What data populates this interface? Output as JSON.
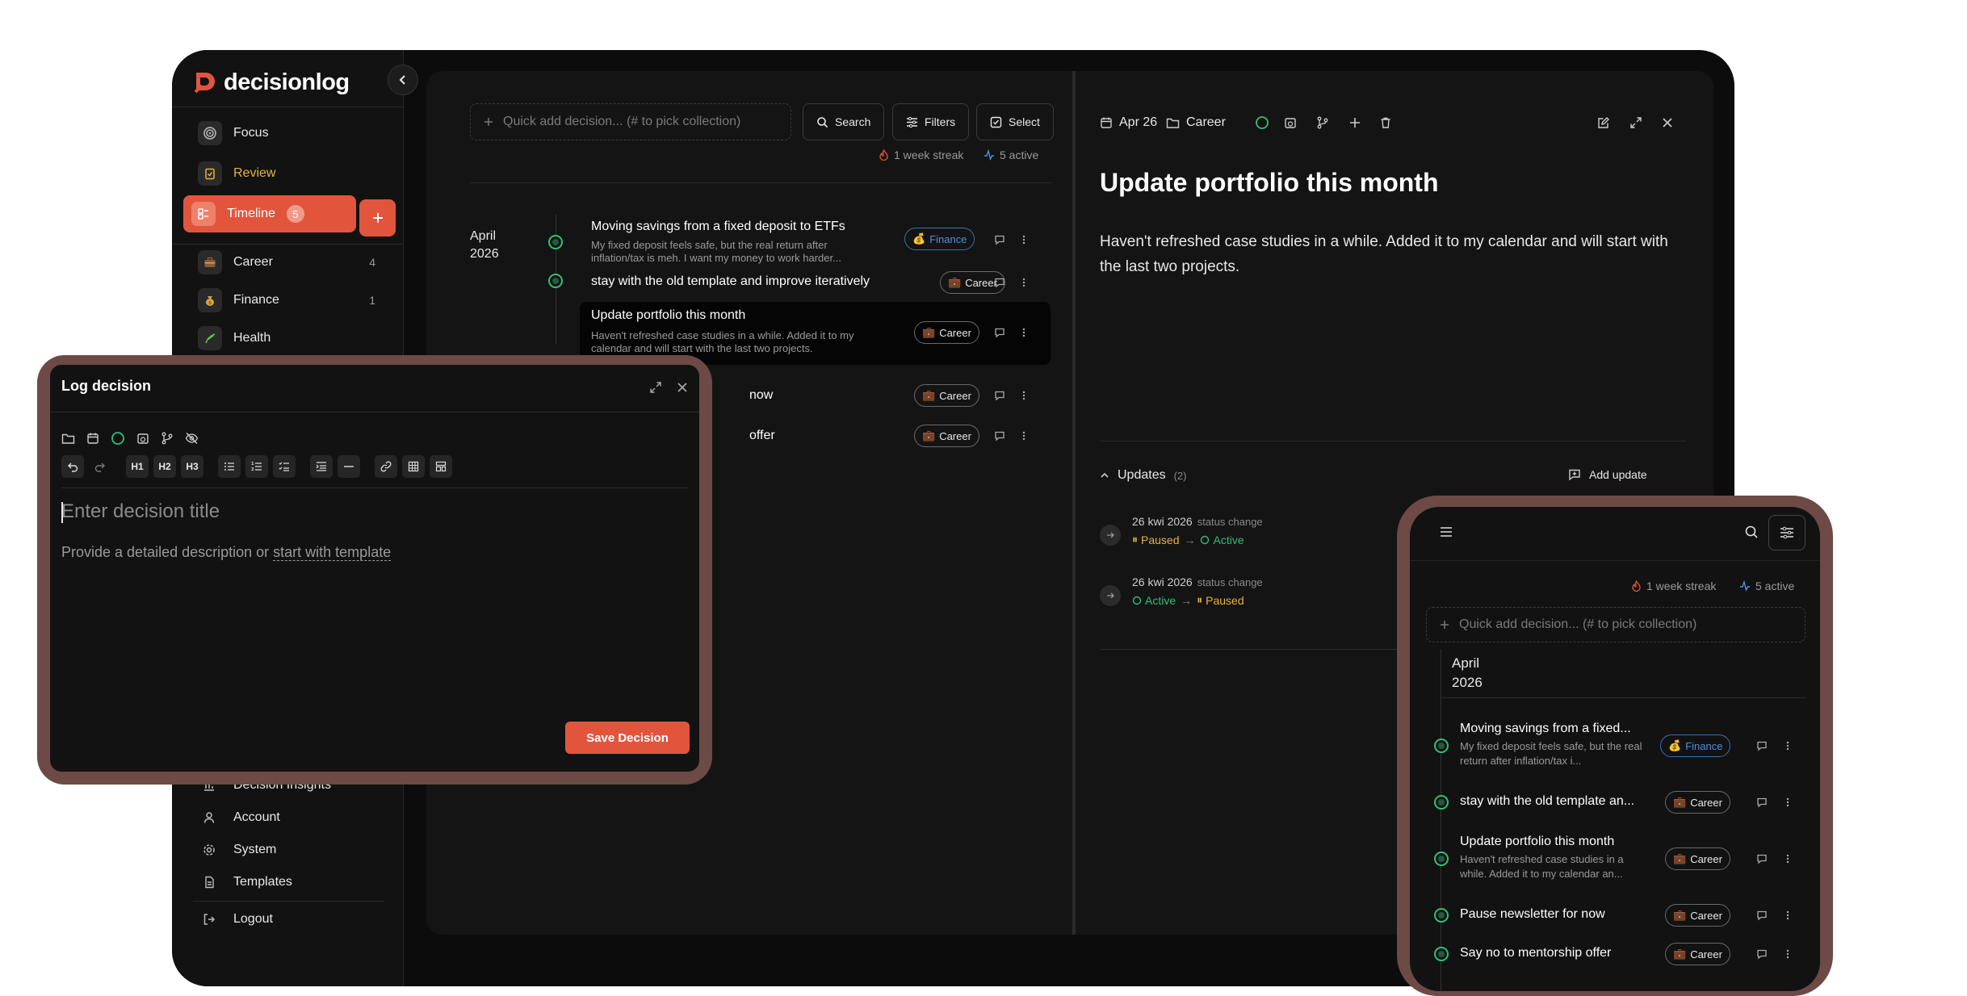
{
  "app": {
    "name": "decisionlog",
    "brand_color": "#e2553d",
    "success_color": "#2fbf7a",
    "warning_color": "#e9b23c"
  },
  "sidebar": {
    "primary": [
      {
        "label": "Focus",
        "icon": "target-icon"
      },
      {
        "label": "Review",
        "icon": "clipboard-icon"
      },
      {
        "label": "Timeline",
        "icon": "timeline-icon",
        "badge": "5"
      }
    ],
    "collections": [
      {
        "label": "Career",
        "count": "4",
        "icon": "briefcase-icon"
      },
      {
        "label": "Finance",
        "count": "1",
        "icon": "money-bag-icon"
      },
      {
        "label": "Health",
        "icon": "herb-icon"
      }
    ],
    "footer": [
      {
        "label": "Decision Insights",
        "icon": "chart-icon"
      },
      {
        "label": "Account",
        "icon": "user-icon"
      },
      {
        "label": "System",
        "icon": "gear-icon"
      },
      {
        "label": "Templates",
        "icon": "file-icon"
      },
      {
        "label": "Logout",
        "icon": "logout-icon"
      }
    ]
  },
  "toolbar": {
    "quick_add_placeholder": "Quick add decision... (# to pick collection)",
    "search_label": "Search",
    "filters_label": "Filters",
    "select_label": "Select",
    "streak": "1 week streak",
    "active": "5 active"
  },
  "timeline": {
    "month": "April",
    "year": "2026",
    "items": [
      {
        "title": "Moving savings from a fixed deposit to ETFs",
        "desc": "My fixed deposit feels safe, but the real return after inflation/tax is meh. I want my money to work harder...",
        "tag": "Finance"
      },
      {
        "title": "stay with the old template and improve iteratively",
        "desc": "",
        "tag": "Career"
      },
      {
        "title": "Update portfolio this month",
        "desc": "Haven't refreshed case studies in a while. Added it to my calendar and will start with the last two projects.",
        "tag": "Career"
      },
      {
        "title": "Pause newsletter for now",
        "desc": "",
        "tag": "Career",
        "visible_fragment": "now"
      },
      {
        "title": "Say no to mentorship offer",
        "desc": "",
        "tag": "Career",
        "visible_fragment": "offer"
      }
    ]
  },
  "detail": {
    "date": "Apr 26",
    "collection": "Career",
    "title": "Update portfolio this month",
    "body": "Haven't refreshed case studies in a while. Added it to my calendar and will start with the last two projects.",
    "updates_label": "Updates",
    "updates_count": "(2)",
    "add_update_label": "Add update",
    "updates": [
      {
        "date": "26 kwi 2026",
        "kind": "status change",
        "from": "Paused",
        "to": "Active"
      },
      {
        "date": "26 kwi 2026",
        "kind": "status change",
        "from": "Active",
        "to": "Paused"
      }
    ]
  },
  "modal": {
    "title": "Log decision",
    "format_buttons": [
      "H1",
      "H2",
      "H3"
    ],
    "title_placeholder": "Enter decision title",
    "desc_prefix": "Provide a detailed description or ",
    "desc_link": "start with template",
    "save_label": "Save Decision"
  },
  "mobile": {
    "streak": "1 week streak",
    "active": "5 active",
    "quick_add_placeholder": "Quick add decision... (# to pick collection)",
    "month": "April",
    "year": "2026",
    "items": [
      {
        "title": "Moving savings from a fixed...",
        "desc": "My fixed deposit feels safe, but the real return after inflation/tax i...",
        "tag": "Finance"
      },
      {
        "title": "stay with the old template an...",
        "desc": "",
        "tag": "Career"
      },
      {
        "title": "Update portfolio this month",
        "desc": "Haven't refreshed case studies in a while. Added it to my calendar an...",
        "tag": "Career"
      },
      {
        "title": "Pause newsletter for now",
        "desc": "",
        "tag": "Career"
      },
      {
        "title": "Say no to mentorship offer",
        "desc": "",
        "tag": "Career"
      }
    ]
  }
}
